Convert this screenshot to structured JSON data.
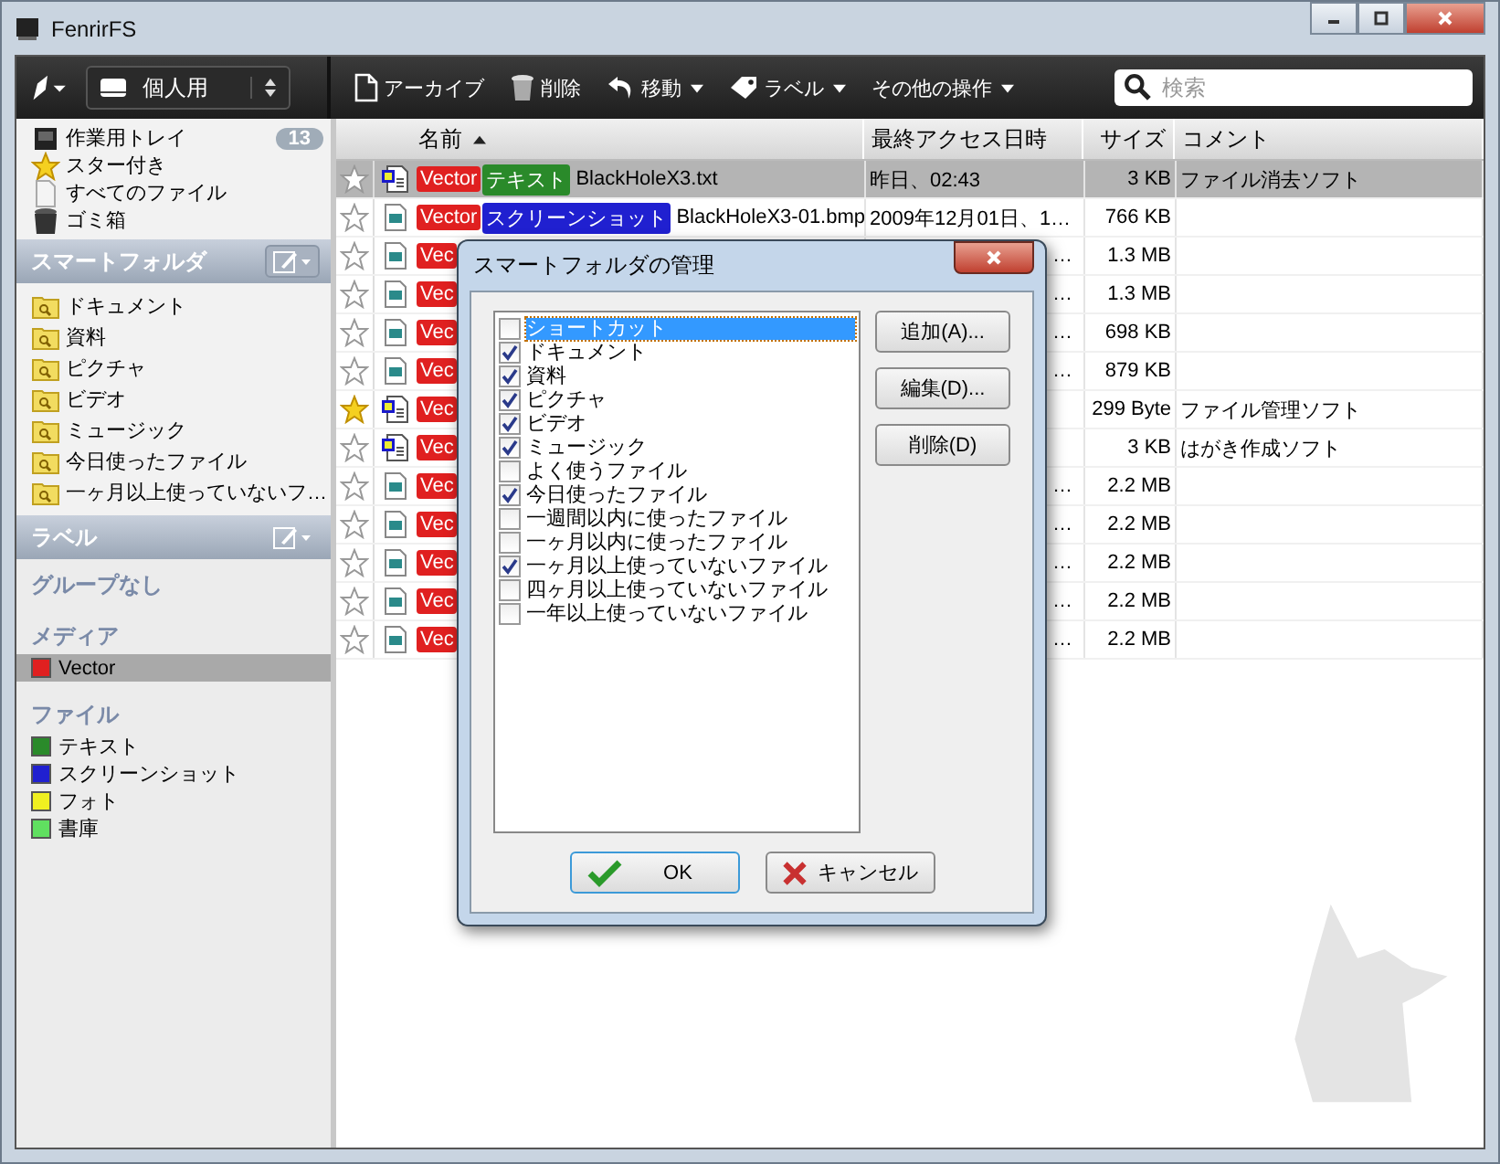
{
  "window": {
    "title": "FenrirFS"
  },
  "toolbar": {
    "profile": "個人用",
    "actions": [
      {
        "label": "アーカイブ",
        "kind": "archive",
        "menu": false
      },
      {
        "label": "削除",
        "kind": "trash",
        "menu": false
      },
      {
        "label": "移動",
        "kind": "move",
        "menu": true
      },
      {
        "label": "ラベル",
        "kind": "tag",
        "menu": true
      },
      {
        "label": "その他の操作",
        "kind": "none",
        "menu": true
      }
    ],
    "search": {
      "placeholder": "検索"
    }
  },
  "sidebar": {
    "places": [
      {
        "label": "作業用トレイ",
        "kind": "tray",
        "badge": "13"
      },
      {
        "label": "スター付き",
        "kind": "star"
      },
      {
        "label": "すべてのファイル",
        "kind": "file"
      },
      {
        "label": "ゴミ箱",
        "kind": "trash"
      }
    ],
    "smart_folders": {
      "title": "スマートフォルダ",
      "items": [
        "ドキュメント",
        "資料",
        "ピクチャ",
        "ビデオ",
        "ミュージック",
        "今日使ったファイル",
        "一ヶ月以上使っていないフ…"
      ]
    },
    "labels": {
      "title": "ラベル",
      "groups": [
        {
          "name": "グループなし"
        },
        {
          "name": "メディア",
          "items": [
            {
              "label": "Vector",
              "color": "#e02020",
              "selected": true
            }
          ]
        },
        {
          "name": "ファイル",
          "items": [
            {
              "label": "テキスト",
              "color": "#2a8a2a",
              "selected": false
            },
            {
              "label": "スクリーンショット",
              "color": "#2020d0",
              "selected": false
            },
            {
              "label": "フォト",
              "color": "#f0f020",
              "selected": false
            },
            {
              "label": "書庫",
              "color": "#60e060",
              "selected": false
            }
          ]
        }
      ]
    }
  },
  "files": {
    "columns": [
      {
        "label": "名前",
        "sorted": true
      },
      {
        "label": "最終アクセス日時",
        "sorted": false
      },
      {
        "label": "サイズ",
        "sorted": false
      },
      {
        "label": "コメント",
        "sorted": false
      }
    ],
    "rows": [
      {
        "selected": true,
        "starred": false,
        "kind": "text",
        "labels": [
          {
            "text": "Vector",
            "color": "#e02020"
          },
          {
            "text": "テキスト",
            "color": "#2a8a2a"
          }
        ],
        "name": "BlackHoleX3.txt",
        "date": "昨日、02:43",
        "size": "3 KB",
        "comment": "ファイル消去ソフト"
      },
      {
        "selected": false,
        "starred": false,
        "kind": "image",
        "labels": [
          {
            "text": "Vector",
            "color": "#e02020"
          },
          {
            "text": "スクリーンショット",
            "color": "#2020d0"
          }
        ],
        "name": "BlackHoleX3-01.bmp",
        "date": "2009年12月01日、1…",
        "size": "766 KB",
        "comment": ""
      },
      {
        "selected": false,
        "starred": false,
        "kind": "image",
        "labels": [
          {
            "text": "Vec",
            "color": "#e02020"
          }
        ],
        "name": "",
        "date": "…",
        "size": "1.3 MB",
        "comment": ""
      },
      {
        "selected": false,
        "starred": false,
        "kind": "image",
        "labels": [
          {
            "text": "Vec",
            "color": "#e02020"
          }
        ],
        "name": "",
        "date": "…",
        "size": "1.3 MB",
        "comment": ""
      },
      {
        "selected": false,
        "starred": false,
        "kind": "image",
        "labels": [
          {
            "text": "Vec",
            "color": "#e02020"
          }
        ],
        "name": "",
        "date": "…",
        "size": "698 KB",
        "comment": ""
      },
      {
        "selected": false,
        "starred": false,
        "kind": "image",
        "labels": [
          {
            "text": "Vec",
            "color": "#e02020"
          }
        ],
        "name": "",
        "date": "…",
        "size": "879 KB",
        "comment": ""
      },
      {
        "selected": false,
        "starred": true,
        "kind": "text",
        "labels": [
          {
            "text": "Vec",
            "color": "#e02020"
          }
        ],
        "name": "",
        "date": "",
        "size": "299 Byte",
        "comment": "ファイル管理ソフト"
      },
      {
        "selected": false,
        "starred": false,
        "kind": "text",
        "labels": [
          {
            "text": "Vec",
            "color": "#e02020"
          }
        ],
        "name": "",
        "date": "",
        "size": "3 KB",
        "comment": "はがき作成ソフト"
      },
      {
        "selected": false,
        "starred": false,
        "kind": "image",
        "labels": [
          {
            "text": "Vec",
            "color": "#e02020"
          }
        ],
        "name": "",
        "date": "…",
        "size": "2.2 MB",
        "comment": ""
      },
      {
        "selected": false,
        "starred": false,
        "kind": "image",
        "labels": [
          {
            "text": "Vec",
            "color": "#e02020"
          }
        ],
        "name": "",
        "date": "…",
        "size": "2.2 MB",
        "comment": ""
      },
      {
        "selected": false,
        "starred": false,
        "kind": "image",
        "labels": [
          {
            "text": "Vec",
            "color": "#e02020"
          }
        ],
        "name": "",
        "date": "…",
        "size": "2.2 MB",
        "comment": ""
      },
      {
        "selected": false,
        "starred": false,
        "kind": "image",
        "labels": [
          {
            "text": "Vec",
            "color": "#e02020"
          }
        ],
        "name": "",
        "date": "…",
        "size": "2.2 MB",
        "comment": ""
      },
      {
        "selected": false,
        "starred": false,
        "kind": "image",
        "labels": [
          {
            "text": "Vec",
            "color": "#e02020"
          }
        ],
        "name": "",
        "date": "…",
        "size": "2.2 MB",
        "comment": ""
      }
    ]
  },
  "dialog": {
    "title": "スマートフォルダの管理",
    "items": [
      {
        "label": "ショートカット",
        "checked": false,
        "selected": true
      },
      {
        "label": "ドキュメント",
        "checked": true,
        "selected": false
      },
      {
        "label": "資料",
        "checked": true,
        "selected": false
      },
      {
        "label": "ピクチャ",
        "checked": true,
        "selected": false
      },
      {
        "label": "ビデオ",
        "checked": true,
        "selected": false
      },
      {
        "label": "ミュージック",
        "checked": true,
        "selected": false
      },
      {
        "label": "よく使うファイル",
        "checked": false,
        "selected": false
      },
      {
        "label": "今日使ったファイル",
        "checked": true,
        "selected": false
      },
      {
        "label": "一週間以内に使ったファイル",
        "checked": false,
        "selected": false
      },
      {
        "label": "一ヶ月以内に使ったファイル",
        "checked": false,
        "selected": false
      },
      {
        "label": "一ヶ月以上使っていないファイル",
        "checked": true,
        "selected": false
      },
      {
        "label": "四ヶ月以上使っていないファイル",
        "checked": false,
        "selected": false
      },
      {
        "label": "一年以上使っていないファイル",
        "checked": false,
        "selected": false
      }
    ],
    "side_buttons": [
      "追加(A)...",
      "編集(D)...",
      "削除(D)"
    ],
    "ok": "OK",
    "cancel": "キャンセル"
  }
}
